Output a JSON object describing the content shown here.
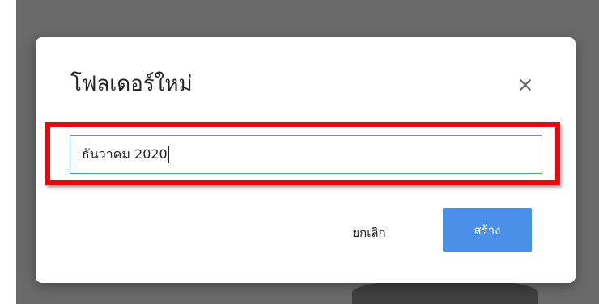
{
  "dialog": {
    "title": "โฟลเดอร์ใหม่",
    "close_icon": "close-icon",
    "folder_name_value": "ธันวาคม 2020",
    "cancel_label": "ยกเลิก",
    "create_label": "สร้าง"
  },
  "colors": {
    "highlight": "#e8080d",
    "primary_button": "#4a90e8",
    "input_border": "#4d90fe",
    "backdrop": "#6a6a6a"
  }
}
